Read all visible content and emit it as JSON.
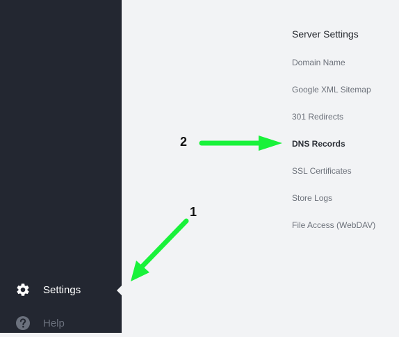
{
  "sidebar": {
    "items": [
      {
        "label": "Settings",
        "icon": "gear-icon",
        "active": true
      },
      {
        "label": "Help",
        "icon": "help-icon",
        "active": false
      }
    ]
  },
  "submenu": {
    "heading": "Server Settings",
    "items": [
      {
        "label": "Domain Name"
      },
      {
        "label": "Google XML Sitemap"
      },
      {
        "label": "301 Redirects"
      },
      {
        "label": "DNS Records",
        "active": true
      },
      {
        "label": "SSL Certificates"
      },
      {
        "label": "Store Logs"
      },
      {
        "label": "File Access (WebDAV)"
      }
    ]
  },
  "annotations": {
    "step1": "1",
    "step2": "2",
    "arrow_color": "#19f23a"
  },
  "colors": {
    "sidebar_bg": "#232731",
    "content_bg": "#f2f3f5"
  }
}
